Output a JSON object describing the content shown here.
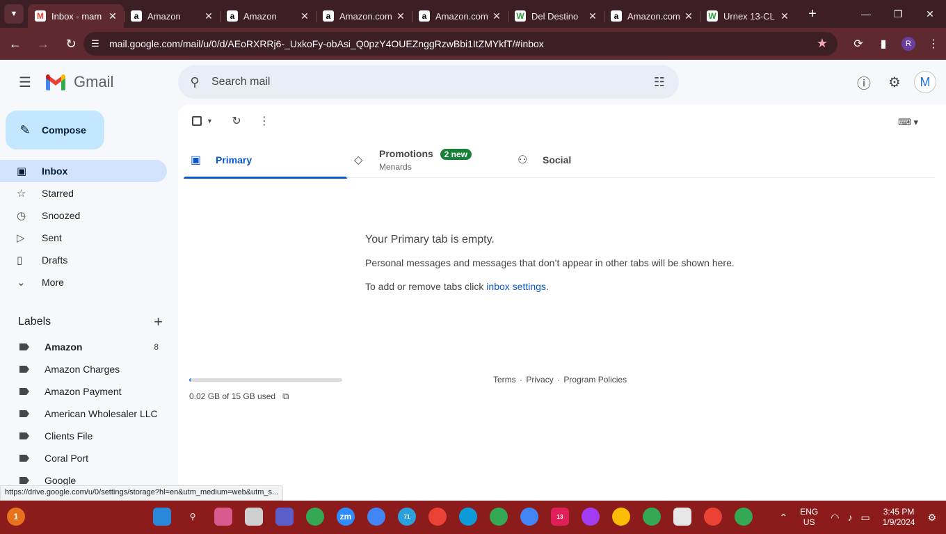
{
  "browser": {
    "tabs": [
      {
        "title": "Inbox - mam",
        "favicon": "gmail-icon",
        "active": true
      },
      {
        "title": "Amazon",
        "favicon": "amazon-icon"
      },
      {
        "title": "Amazon",
        "favicon": "amazon-icon"
      },
      {
        "title": "Amazon.com",
        "favicon": "amazon-icon"
      },
      {
        "title": "Amazon.com",
        "favicon": "amazon-icon"
      },
      {
        "title": "Del Destino",
        "favicon": "green-w-icon"
      },
      {
        "title": "Amazon.com",
        "favicon": "amazon-icon"
      },
      {
        "title": "Urnex 13-CL",
        "favicon": "green-w-icon"
      }
    ],
    "url": "mail.google.com/mail/u/0/d/AEoRXRRj6-_UxkoFy-obAsi_Q0pzY4OUEZnggRzwBbi1ItZMYkfT/#inbox",
    "profile_initial": "R",
    "accent_color": "#5e2a30"
  },
  "gmail": {
    "brand": "Gmail",
    "search": {
      "placeholder": "Search mail"
    },
    "account_initial": "M",
    "compose_label": "Compose",
    "nav": [
      {
        "label": "Inbox",
        "icon": "inbox-icon",
        "active": true
      },
      {
        "label": "Starred",
        "icon": "star-icon"
      },
      {
        "label": "Snoozed",
        "icon": "clock-icon"
      },
      {
        "label": "Sent",
        "icon": "send-icon"
      },
      {
        "label": "Drafts",
        "icon": "draft-icon"
      },
      {
        "label": "More",
        "icon": "chevron-down-icon"
      }
    ],
    "labels_title": "Labels",
    "labels": [
      {
        "label": "Amazon",
        "count": "8",
        "bold": true
      },
      {
        "label": "Amazon Charges"
      },
      {
        "label": "Amazon Payment"
      },
      {
        "label": "American Wholesaler LLC"
      },
      {
        "label": "Clients File"
      },
      {
        "label": "Coral Port"
      },
      {
        "label": "Google"
      }
    ],
    "category_tabs": [
      {
        "label": "Primary",
        "icon": "inbox-icon",
        "active": true
      },
      {
        "label": "Promotions",
        "icon": "tag-icon",
        "badge": "2 new",
        "subtitle": "Menards"
      },
      {
        "label": "Social",
        "icon": "people-icon"
      }
    ],
    "empty_state": {
      "heading": "Your Primary tab is empty.",
      "line1": "Personal messages and messages that don’t appear in other tabs will be shown here.",
      "line2_prefix": "To add or remove tabs click ",
      "line2_link": "inbox settings",
      "line2_suffix": "."
    },
    "storage": {
      "text": "0.02 GB of 15 GB used",
      "used_fraction": 0.0013
    },
    "footer": {
      "terms": "Terms",
      "sep": "·",
      "privacy": "Privacy",
      "policies": "Program Policies"
    },
    "status_url": "https://drive.google.com/u/0/settings/storage?hl=en&utm_medium=web&utm_s..."
  },
  "taskbar": {
    "lang": "ENG",
    "region": "US",
    "time": "3:45 PM",
    "date": "1/9/2024",
    "telegram_badge": "71",
    "slack_badge": "13",
    "notif_badge": "1",
    "color": "#8c1c1c"
  }
}
